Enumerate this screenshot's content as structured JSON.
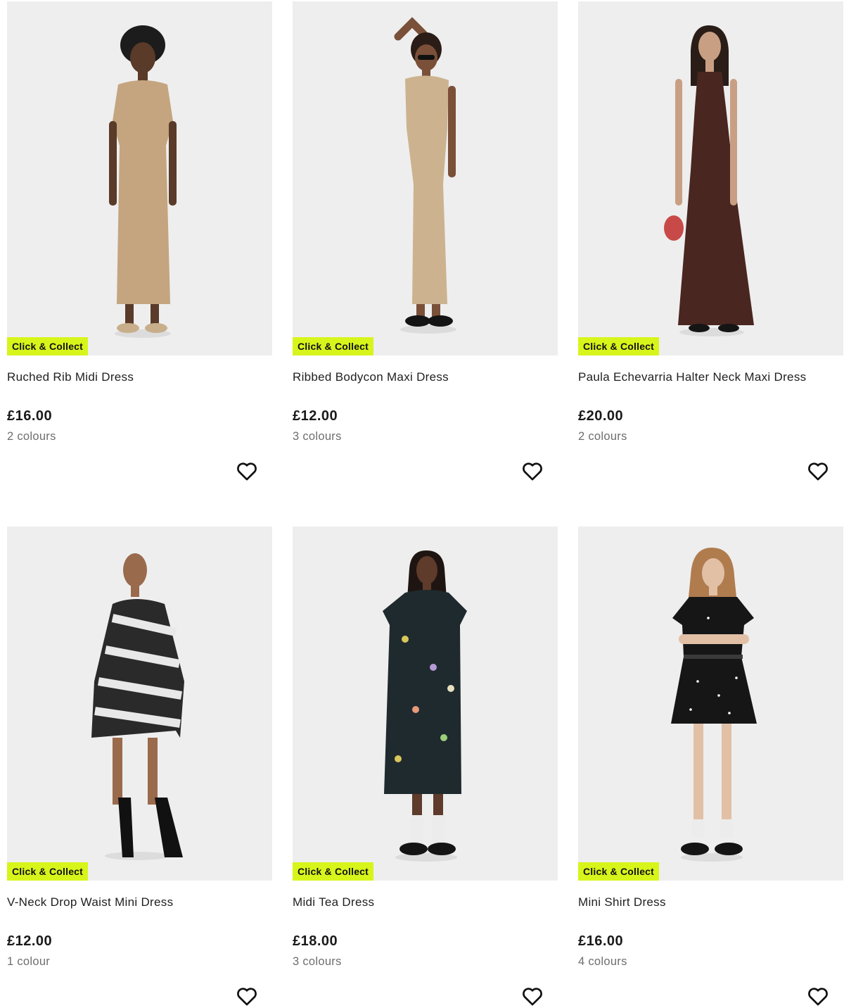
{
  "colors": {
    "badge_bg": "#d8f51b",
    "price": "#1a1a1a",
    "colours_text": "#6e6e6e",
    "photo_bg": "#eeeeee"
  },
  "products": [
    {
      "badge": "Click & Collect",
      "name": "Ruched Rib Midi Dress",
      "price": "£16.00",
      "colours": "2 colours",
      "dress_color": "#c4a57f",
      "icon": "heart-outline-icon"
    },
    {
      "badge": "Click & Collect",
      "name": "Ribbed Bodycon Maxi Dress",
      "price": "£12.00",
      "colours": "3 colours",
      "dress_color": "#cdb28f",
      "icon": "heart-outline-icon"
    },
    {
      "badge": "Click & Collect",
      "name": "Paula Echevarria Halter Neck Maxi Dress",
      "price": "£20.00",
      "colours": "2 colours",
      "dress_color": "#4a2621",
      "icon": "heart-outline-icon"
    },
    {
      "badge": "Click & Collect",
      "name": "V-Neck Drop Waist Mini Dress",
      "price": "£12.00",
      "colours": "1 colour",
      "dress_color": "#2a2a2a",
      "icon": "heart-outline-icon"
    },
    {
      "badge": "Click & Collect",
      "name": "Midi Tea Dress",
      "price": "£18.00",
      "colours": "3 colours",
      "dress_color": "#1f2a2e",
      "icon": "heart-outline-icon"
    },
    {
      "badge": "Click & Collect",
      "name": "Mini Shirt Dress",
      "price": "£16.00",
      "colours": "4 colours",
      "dress_color": "#161616",
      "icon": "heart-outline-icon"
    }
  ]
}
